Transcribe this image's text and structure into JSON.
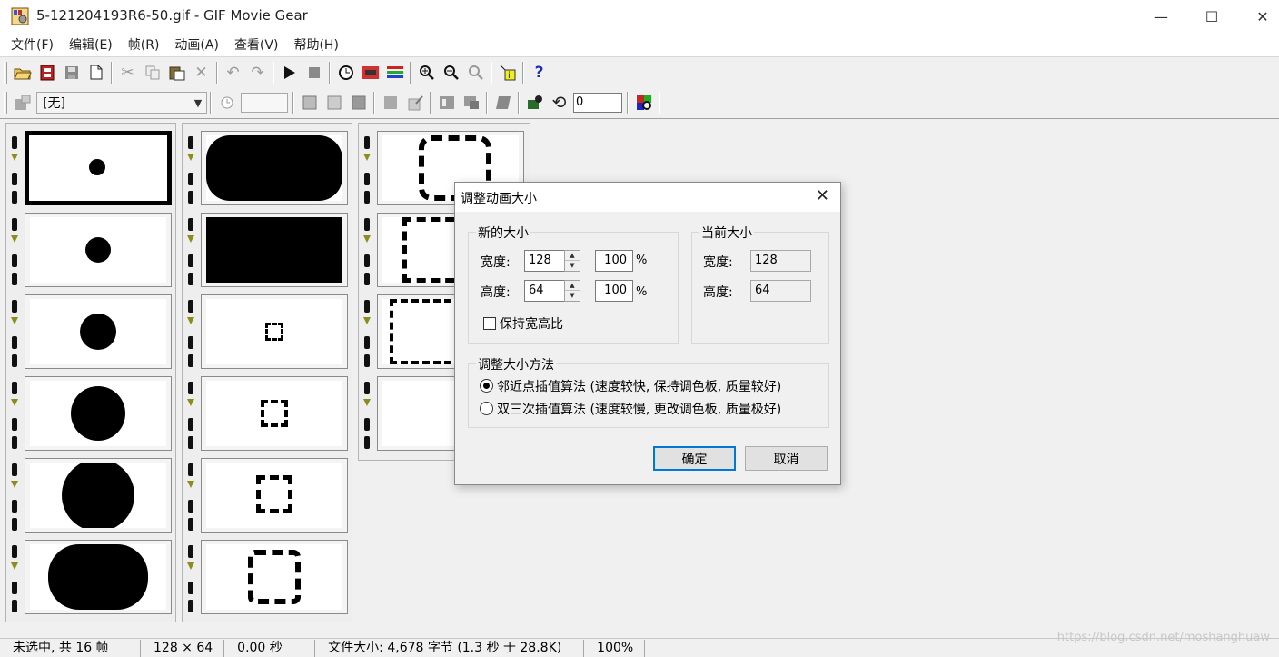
{
  "window": {
    "title": "5-121204193R6-50.gif - GIF Movie Gear",
    "minimize": "—",
    "maximize": "☐",
    "close": "✕"
  },
  "menu": [
    "文件(F)",
    "编辑(E)",
    "帧(R)",
    "动画(A)",
    "查看(V)",
    "帮助(H)"
  ],
  "toolbar2": {
    "combo_value": "[无]",
    "rotate_value": "0"
  },
  "statusbar": {
    "selection": "未选中, 共 16 帧",
    "dimensions": "128 × 64",
    "time": "0.00 秒",
    "filesize": "文件大小: 4,678 字节  (1.3 秒 于 28.8K)",
    "zoom": "100%"
  },
  "watermark": "https://blog.csdn.net/moshanghuaw",
  "dialog": {
    "title": "调整动画大小",
    "close": "✕",
    "new_size": {
      "label": "新的大小",
      "width_label": "宽度:",
      "width_value": "128",
      "width_percent": "100",
      "height_label": "高度:",
      "height_value": "64",
      "height_percent": "100",
      "percent_sign": "%",
      "keep_ratio": "保持宽高比",
      "keep_ratio_checked": false
    },
    "current_size": {
      "label": "当前大小",
      "width_label": "宽度:",
      "width_value": "128",
      "height_label": "高度:",
      "height_value": "64"
    },
    "method": {
      "label": "调整大小方法",
      "option1": "邻近点插值算法 (速度较快, 保持调色板, 质量较好)",
      "option2": "双三次插值算法 (速度较慢, 更改调色板, 质量极好)",
      "selected": "option1"
    },
    "ok": "确定",
    "cancel": "取消"
  },
  "colors": {
    "accent": "#0078d7",
    "frame_marker": "#8c8c1e"
  }
}
